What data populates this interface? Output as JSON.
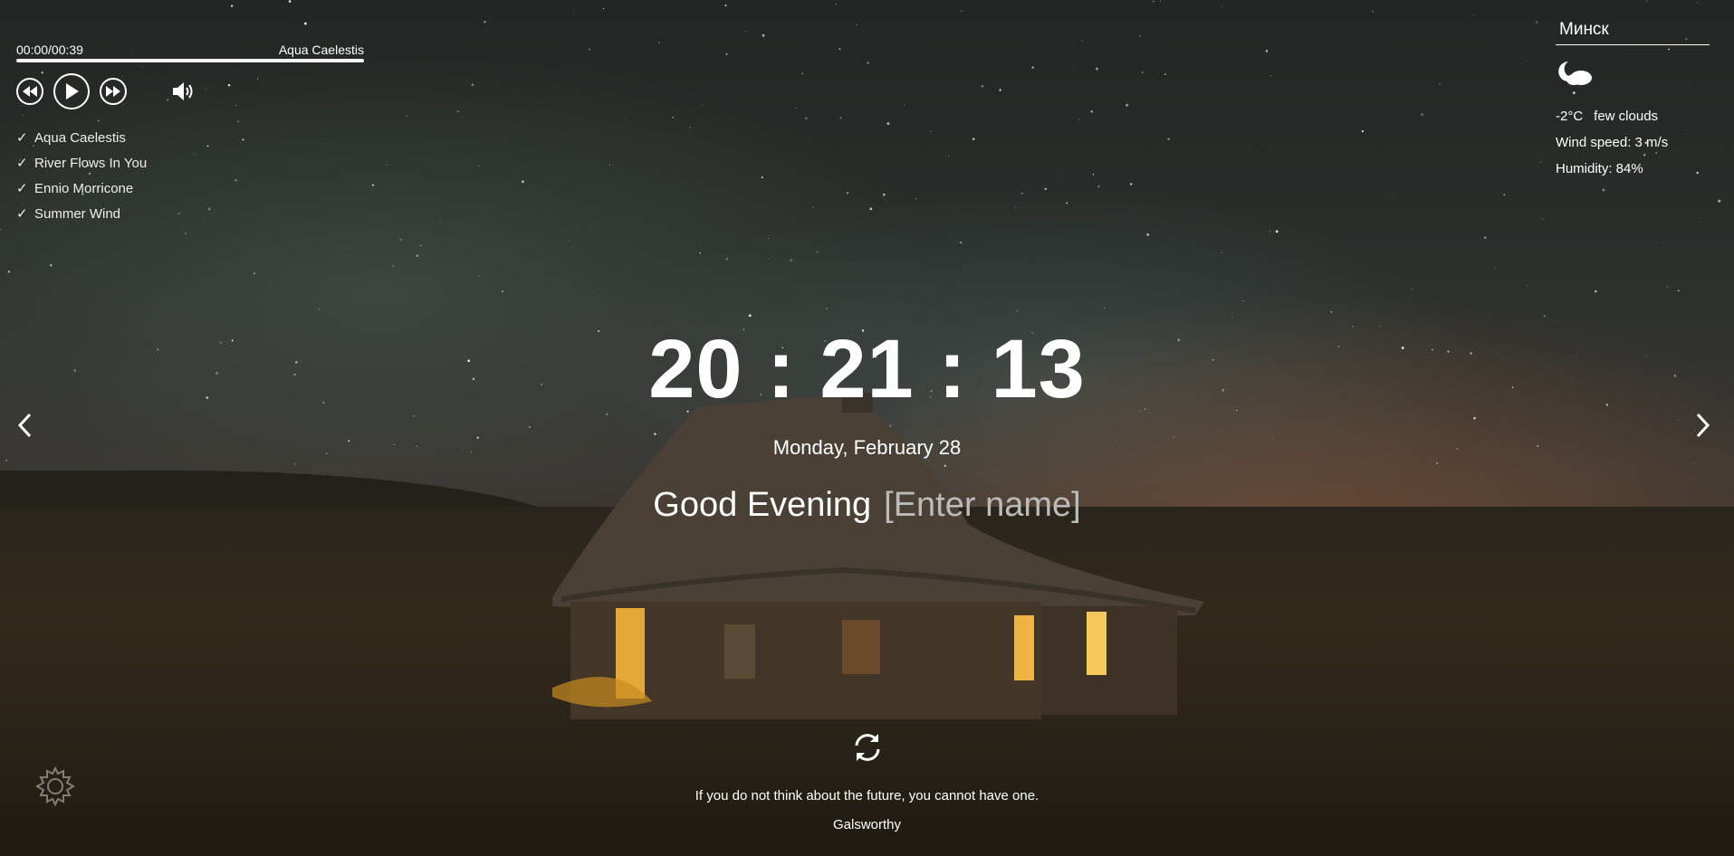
{
  "player": {
    "time": "00:00/00:39",
    "current_track": "Aqua Caelestis",
    "progress": 1.0,
    "playlist": [
      "Aqua Caelestis",
      "River Flows In You",
      "Ennio Morricone",
      "Summer Wind"
    ],
    "icons": {
      "prev": "rewind-icon",
      "play": "play-icon",
      "next": "fast-forward-icon",
      "volume": "volume-icon",
      "check": "check-icon"
    }
  },
  "weather": {
    "city": "Минск",
    "icon": "few-clouds-night-icon",
    "temperature": "-2°C",
    "description": "few clouds",
    "wind": "Wind speed: 3 m/s",
    "humidity": "Humidity: 84%"
  },
  "clock": {
    "hours": "20",
    "minutes": "21",
    "seconds": "13",
    "separator": ":"
  },
  "date": "Monday, February 28",
  "greeting": {
    "text": "Good Evening",
    "name_placeholder": "[Enter name]"
  },
  "quote": {
    "text": "If you do not think about the future, you cannot have one.",
    "author": "Galsworthy"
  },
  "icons": {
    "prev_slide": "chevron-left-icon",
    "next_slide": "chevron-right-icon",
    "refresh": "refresh-icon",
    "settings": "gear-icon"
  }
}
